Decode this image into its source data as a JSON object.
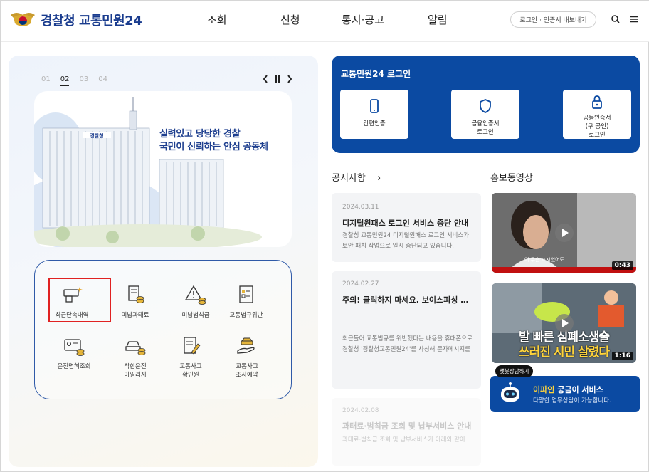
{
  "header": {
    "brand": "경찰청 교통민원24",
    "menu": [
      "조회",
      "신청",
      "통지·공고",
      "알림"
    ],
    "login_pill": "로그인 · 인증서 내보내기"
  },
  "slider": {
    "numbers": [
      "01",
      "02",
      "03",
      "04"
    ],
    "active": "02",
    "banner_line1": "실력있고 당당한 경찰",
    "banner_line2": "국민이 신뢰하는 안심 공동체",
    "building_sign": "경찰청"
  },
  "quick_menu": [
    {
      "label": "최근단속내역",
      "icon": "camera-sparkle-icon"
    },
    {
      "label": "미납과태료",
      "icon": "bill-coins-icon"
    },
    {
      "label": "미납범칙금",
      "icon": "warning-coins-icon"
    },
    {
      "label": "교통법규위반",
      "icon": "document-check-icon"
    },
    {
      "label": "운전면허조회",
      "icon": "license-card-icon"
    },
    {
      "label": "착한운전\n마일리지",
      "icon": "car-coins-icon"
    },
    {
      "label": "교통사고\n확인원",
      "icon": "document-pen-icon"
    },
    {
      "label": "교통사고\n조사예약",
      "icon": "hand-car-icon"
    }
  ],
  "login_card": {
    "title": "교통민원24 로그인",
    "buttons": [
      {
        "label": "간편인증",
        "icon": "phone-icon"
      },
      {
        "label": "금융인증서\n로그인",
        "icon": "shield-icon"
      },
      {
        "label": "공동인증서\n(구 공인)\n로그인",
        "icon": "lock-icon"
      }
    ]
  },
  "notice": {
    "title": "공지사항",
    "more": "›",
    "items": [
      {
        "date": "2024.03.11",
        "title": "디지털원패스 로그인 서비스 중단 안내",
        "body1": "경찰청 교통민원24 디지털원패스 로그인 서비스가",
        "body2": "보안 패치 작업으로 일시 중단되고 있습니다."
      },
      {
        "date": "2024.02.27",
        "title": "주의! 클릭하지 마세요. 보이스피싱 문자 주의",
        "body1": "최근들어 교통법규를 위반했다는 내용을 휴대폰으로",
        "body2": "경찰청 '경찰청교통민원24'를 사칭해 문자메시지를"
      },
      {
        "date": "2024.02.08",
        "title": "과태료·범칙금 조회 및 납부서비스 안내",
        "body1": "과태료·범칙금 조회 및 납부서비스가 아래와 같이",
        "body2": ""
      }
    ]
  },
  "videos": {
    "title": "홍보동영상",
    "items": [
      {
        "duration": "0:43",
        "caption": "어 무슨 표시였어도"
      },
      {
        "duration": "1:16",
        "caption_line1": "발 빠른 심폐소생술",
        "caption_line2": "쓰러진 시민 살렸다"
      }
    ]
  },
  "chatbot": {
    "bubble": "챗봇상담하기",
    "title_em": "이파인",
    "title_rest": " 궁금이 서비스",
    "subtitle": "다양한 업무상담이 가능합니다."
  },
  "colors": {
    "primary": "#0b4aa2",
    "highlight": "#e02222",
    "brand_text": "#1a3c8e"
  }
}
